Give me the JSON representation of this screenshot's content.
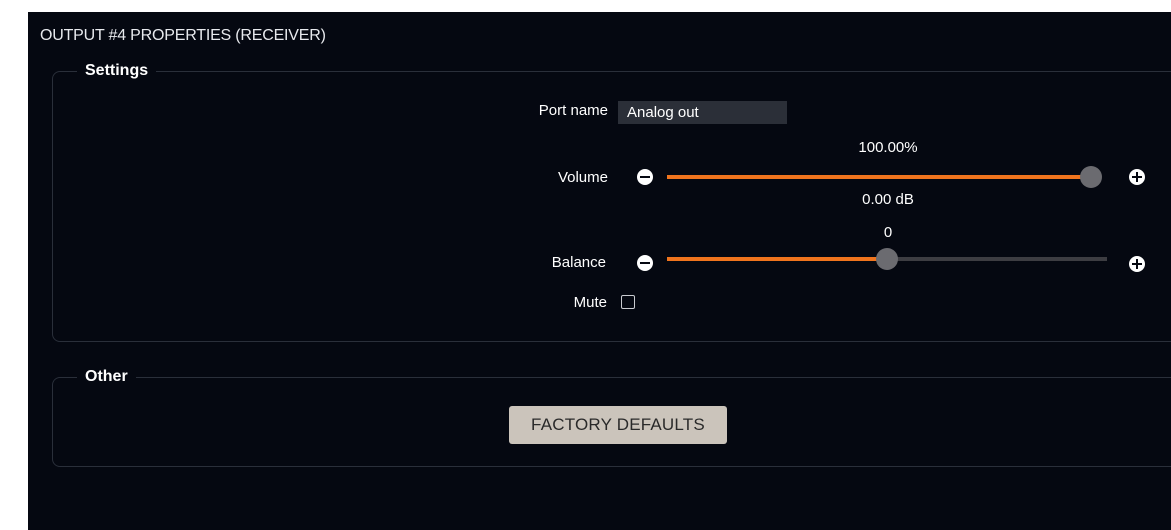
{
  "panel": {
    "title": "OUTPUT #4 PROPERTIES (RECEIVER)"
  },
  "settings": {
    "legend": "Settings",
    "port_name": {
      "label": "Port name",
      "value": "Analog out",
      "placeholder": ""
    },
    "volume": {
      "label": "Volume",
      "percent_text": "100.00%",
      "db_text": "0.00 dB",
      "level": 0.985,
      "fill_color": "#f0741d",
      "decrease_icon": "minus-circle-icon",
      "increase_icon": "plus-circle-icon"
    },
    "balance": {
      "label": "Balance",
      "value_text": "0",
      "level": 0.5,
      "fill_color": "#f0741d",
      "decrease_icon": "minus-circle-icon",
      "increase_icon": "plus-circle-icon"
    },
    "mute": {
      "label": "Mute",
      "checked": false
    }
  },
  "other": {
    "legend": "Other",
    "factory_defaults_label": "FACTORY DEFAULTS"
  },
  "colors": {
    "background": "#050811",
    "accent": "#f0741d",
    "button": "#cbc4bb",
    "input_bg": "#2b2f38"
  }
}
